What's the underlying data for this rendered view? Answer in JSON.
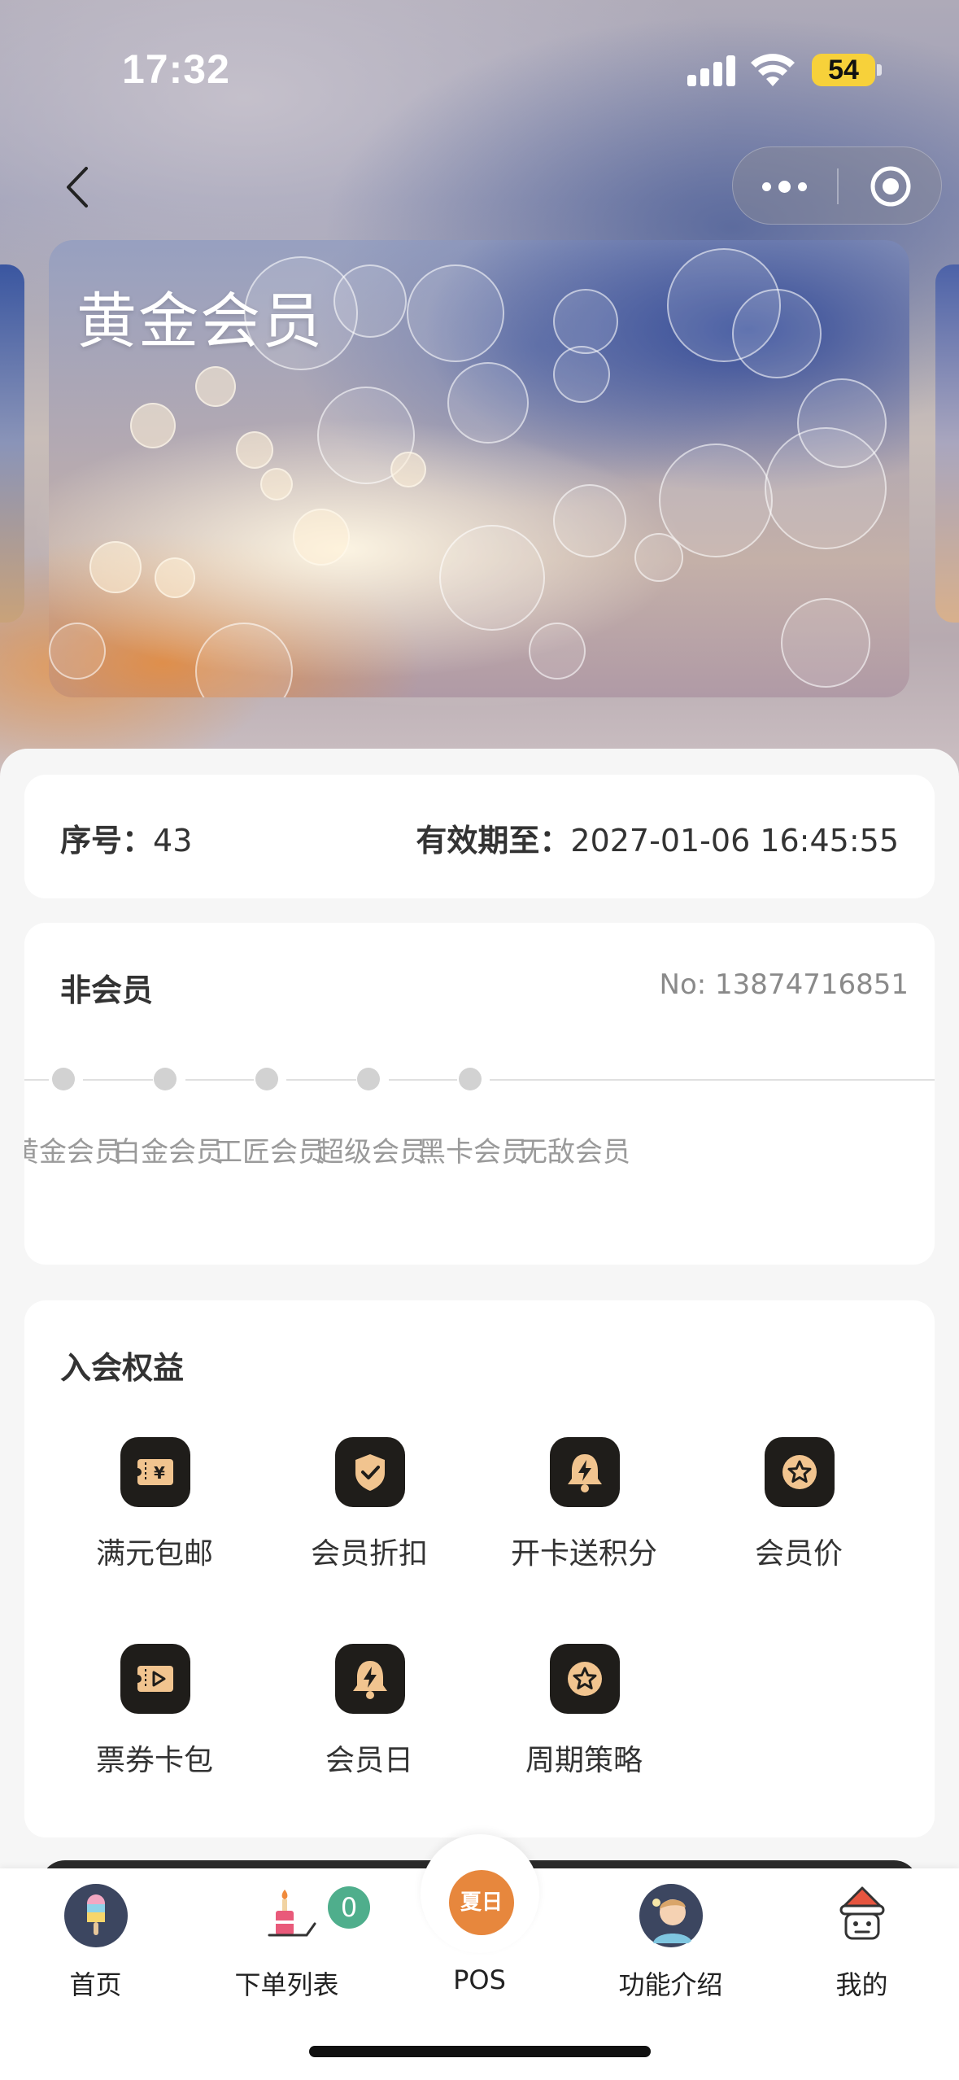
{
  "status_bar": {
    "time": "17:32",
    "battery": "54"
  },
  "nav": {
    "back_icon": "chevron-left-icon",
    "more_icon": "more-dots-icon",
    "close_icon": "target-icon"
  },
  "card": {
    "title": "黄金会员"
  },
  "info": {
    "serial_label": "序号：",
    "serial_value": "43",
    "expiry_label": "有效期至：",
    "expiry_value": "2027-01-06 16:45:55"
  },
  "level": {
    "title": "非会员",
    "member_no": "No: 13874716851",
    "levels": [
      "黄金会员",
      "白金会员",
      "工匠会员",
      "超级会员",
      "黑卡会员",
      "无敌会员"
    ]
  },
  "benefits": {
    "title": "入会权益",
    "items": [
      {
        "label": "满元包邮",
        "icon": "yuan-ticket-icon"
      },
      {
        "label": "会员折扣",
        "icon": "shield-check-icon"
      },
      {
        "label": "开卡送积分",
        "icon": "bell-bolt-icon"
      },
      {
        "label": "会员价",
        "icon": "star-badge-icon"
      },
      {
        "label": "票券卡包",
        "icon": "ticket-play-icon"
      },
      {
        "label": "会员日",
        "icon": "bell-bolt-icon"
      },
      {
        "label": "周期策略",
        "icon": "star-badge-icon"
      }
    ]
  },
  "tabbar": {
    "items": [
      {
        "label": "首页",
        "icon": "popsicle-icon"
      },
      {
        "label": "下单列表",
        "icon": "cake-candle-icon"
      },
      {
        "label": "POS",
        "icon": "summer-sale-icon"
      },
      {
        "label": "功能介绍",
        "icon": "avatar-boy-icon"
      },
      {
        "label": "我的",
        "icon": "avatar-santa-icon"
      }
    ],
    "order_badge": "0",
    "pos_badge_text": "夏日"
  },
  "colors": {
    "accent": "#e7873d",
    "badge": "#4fae8c",
    "icon_tile": "#1f1d1a",
    "icon_fg": "#f1c48f"
  }
}
